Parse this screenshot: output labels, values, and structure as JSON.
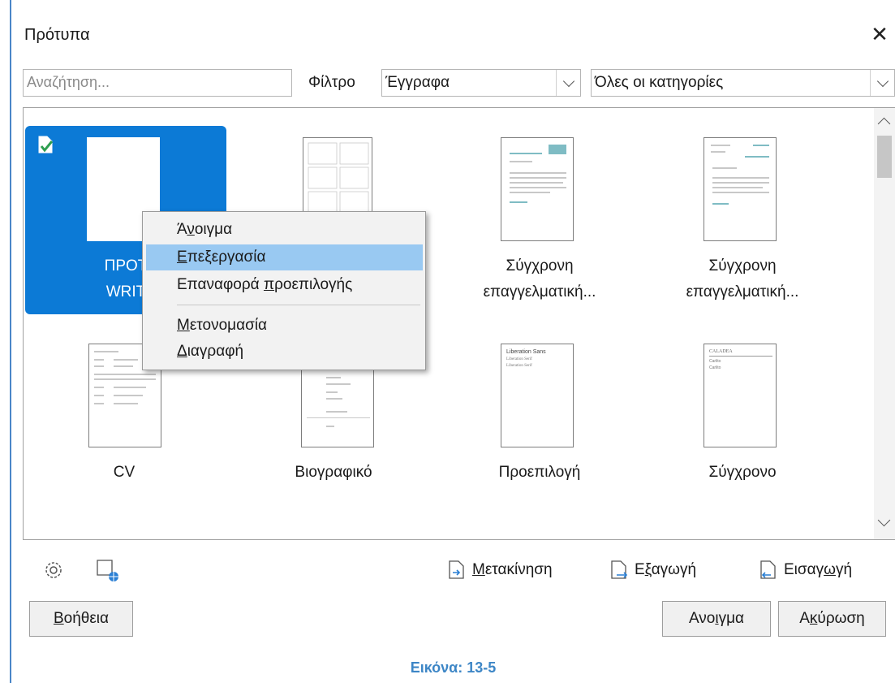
{
  "window": {
    "title": "Πρότυπα",
    "close_glyph": "✕"
  },
  "search": {
    "placeholder": "Αναζήτηση..."
  },
  "filter": {
    "label": "Φίλτρο",
    "doc_type": "Έγγραφα",
    "category": "Όλες οι κατηγορίες"
  },
  "templates": [
    {
      "label_line1": "ΠΡΟΤ",
      "label_line2": "WRIT",
      "selected": true,
      "is_default": true
    },
    {
      "label_line1": "",
      "label_line2": ""
    },
    {
      "label_line1": "Σύγχρονη",
      "label_line2": "επαγγελματική..."
    },
    {
      "label_line1": "Σύγχρονη",
      "label_line2": "επαγγελματική..."
    },
    {
      "label_line1": "CV",
      "label_line2": ""
    },
    {
      "label_line1": "Βιογραφικό",
      "label_line2": ""
    },
    {
      "label_line1": "Προεπιλογή",
      "label_line2": ""
    },
    {
      "label_line1": "Σύγχρονο",
      "label_line2": ""
    }
  ],
  "thumbnail_text": {
    "liberation_title": "Liberation Sans",
    "liberation_line1": "Liberation Serif",
    "liberation_line2": "Liberation Serif",
    "caladea_title": "CALADEA",
    "caladea_line1": "Carlito",
    "caladea_line2": "Carlito"
  },
  "context_menu": {
    "open": {
      "pre": "Ά",
      "acc": "ν",
      "post": "οιγμα"
    },
    "edit": {
      "pre": "",
      "acc": "Ε",
      "post": "πεξεργασία"
    },
    "reset": {
      "pre": "Επαναφορά ",
      "acc": "π",
      "post": "ροεπιλογής"
    },
    "rename": {
      "pre": "",
      "acc": "Μ",
      "post": "ετονομασία"
    },
    "delete": {
      "pre": "",
      "acc": "Δ",
      "post": "ιαγραφή"
    }
  },
  "actions": {
    "move": {
      "pre": "",
      "acc": "Μ",
      "post": "ετακίνηση"
    },
    "export": {
      "pre": "Ε",
      "acc": "ξ",
      "post": "αγωγή"
    },
    "import": {
      "pre": "Εισαγ",
      "acc": "ω",
      "post": "γή"
    }
  },
  "buttons": {
    "help": {
      "pre": "",
      "acc": "Β",
      "post": "οήθεια"
    },
    "open": {
      "pre": "Ανο",
      "acc": "ι",
      "post": "γμα"
    },
    "cancel": {
      "pre": "Α",
      "acc": "κ",
      "post": "ύρωση"
    }
  },
  "caption": "Εικόνα: 13-5",
  "colors": {
    "selection": "#0c7ad6",
    "menu_highlight": "#99c9f2",
    "caption": "#3d86c6"
  },
  "icons": {
    "settings": "gear-icon",
    "online": "globe-document-icon"
  }
}
